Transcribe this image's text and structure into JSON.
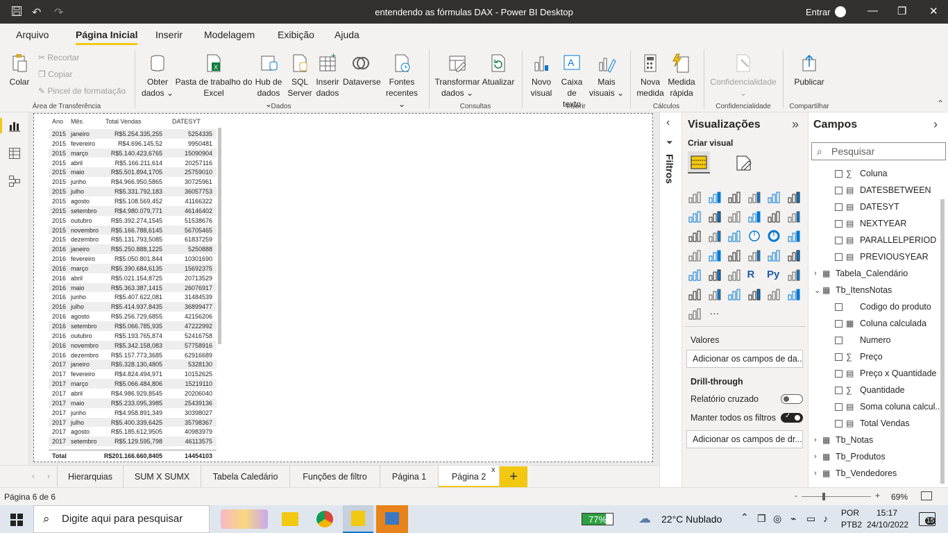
{
  "window": {
    "title": "entendendo as fórmulas DAX - Power BI Desktop",
    "signin": "Entrar"
  },
  "menu": {
    "tabs": [
      "Arquivo",
      "Página Inicial",
      "Inserir",
      "Modelagem",
      "Exibição",
      "Ajuda"
    ],
    "active": "Página Inicial"
  },
  "ribbon": {
    "colar": "Colar",
    "recortar": "Recortar",
    "copiar": "Copiar",
    "pincel": "Pincel de formatação",
    "group_transfer": "Área de Transferência",
    "obter_1": "Obter",
    "obter_2": "dados",
    "excel_1": "Pasta de trabalho do",
    "excel_2": "Excel",
    "hub_1": "Hub de",
    "hub_2": "dados",
    "sql_1": "SQL",
    "sql_2": "Server",
    "inserir_1": "Inserir",
    "inserir_2": "dados",
    "dataverse": "Dataverse",
    "fontes_1": "Fontes",
    "fontes_2": "recentes",
    "group_dados": "Dados",
    "transformar_1": "Transformar",
    "transformar_2": "dados",
    "atualizar": "Atualizar",
    "group_consultas": "Consultas",
    "novo_1": "Novo",
    "novo_2": "visual",
    "caixa_1": "Caixa de",
    "caixa_2": "texto",
    "mais_1": "Mais",
    "mais_2": "visuais",
    "group_inserir": "Inserir",
    "nova_1": "Nova",
    "nova_2": "medida",
    "medida_1": "Medida",
    "medida_2": "rápida",
    "group_calculos": "Cálculos",
    "confid": "Confidencialidade",
    "group_confid": "Confidencialidade",
    "publicar": "Publicar",
    "group_compartilhar": "Compartilhar"
  },
  "table": {
    "headers": [
      "Ano",
      "Mês",
      "Total Vendas",
      "DATESYT"
    ],
    "rows": [
      [
        "2015",
        "janeiro",
        "R$5.254.335,255",
        "5254335"
      ],
      [
        "2015",
        "fevereiro",
        "R$4.696.145,52",
        "9950481"
      ],
      [
        "2015",
        "março",
        "R$5.140.423,6765",
        "15090904"
      ],
      [
        "2015",
        "abril",
        "R$5.166.211,614",
        "20257116"
      ],
      [
        "2015",
        "maio",
        "R$5.501.894,1705",
        "25759010"
      ],
      [
        "2015",
        "junho",
        "R$4.966.950,5865",
        "30725961"
      ],
      [
        "2015",
        "julho",
        "R$5.331.792,183",
        "36057753"
      ],
      [
        "2015",
        "agosto",
        "R$5.108.569,452",
        "41166322"
      ],
      [
        "2015",
        "setembro",
        "R$4.980.079,771",
        "46146402"
      ],
      [
        "2015",
        "outubro",
        "R$5.392.274,1545",
        "51538676"
      ],
      [
        "2015",
        "novembro",
        "R$5.166.788,6145",
        "56705465"
      ],
      [
        "2015",
        "dezembro",
        "R$5.131.793,5085",
        "61837259"
      ],
      [
        "2016",
        "janeiro",
        "R$5.250.888,1225",
        "5250888"
      ],
      [
        "2016",
        "fevereiro",
        "R$5.050.801,844",
        "10301690"
      ],
      [
        "2016",
        "março",
        "R$5.390.684,6135",
        "15692375"
      ],
      [
        "2016",
        "abril",
        "R$5.021.154,8725",
        "20713529"
      ],
      [
        "2016",
        "maio",
        "R$5.363.387,1415",
        "26076917"
      ],
      [
        "2016",
        "junho",
        "R$5.407.622,081",
        "31484539"
      ],
      [
        "2016",
        "julho",
        "R$5.414.937,8435",
        "36899477"
      ],
      [
        "2016",
        "agosto",
        "R$5.256.729,6855",
        "42156206"
      ],
      [
        "2016",
        "setembro",
        "R$5.066.785,935",
        "47222992"
      ],
      [
        "2016",
        "outubro",
        "R$5.193.765,874",
        "52416758"
      ],
      [
        "2016",
        "novembro",
        "R$5.342.158,083",
        "57758916"
      ],
      [
        "2016",
        "dezembro",
        "R$5.157.773,3685",
        "62916689"
      ],
      [
        "2017",
        "janeiro",
        "R$5.328.130,4805",
        "5328130"
      ],
      [
        "2017",
        "fevereiro",
        "R$4.824.494,971",
        "10152625"
      ],
      [
        "2017",
        "março",
        "R$5.066.484,806",
        "15219110"
      ],
      [
        "2017",
        "abril",
        "R$4.986.929,8545",
        "20206040"
      ],
      [
        "2017",
        "maio",
        "R$5.233.095,3985",
        "25439136"
      ],
      [
        "2017",
        "junho",
        "R$4.958.891,349",
        "30398027"
      ],
      [
        "2017",
        "julho",
        "R$5.400.339,6425",
        "35798367"
      ],
      [
        "2017",
        "agosto",
        "R$5.185.612,9505",
        "40983979"
      ],
      [
        "2017",
        "setembro",
        "R$5.129.595,798",
        "46113575"
      ]
    ],
    "total_label": "Total",
    "total_vendas": "R$201.166.660,8405",
    "total_dyt": "14454103"
  },
  "pagetabs": {
    "tabs": [
      "Hierarquias",
      "SUM X SUMX",
      "Tabela Caledário",
      "Funções de filtro",
      "Página 1",
      "Página 2"
    ],
    "active": "Página 2",
    "close": "x",
    "add": "+"
  },
  "status": {
    "page": "Página 6 de 6",
    "zoom": "69%",
    "minus": "-",
    "plus": "+"
  },
  "filtros": {
    "label": "Filtros"
  },
  "viz": {
    "title": "Visualizações",
    "criar": "Criar visual",
    "valores": "Valores",
    "valores_drop": "Adicionar os campos de da...",
    "drill": "Drill-through",
    "relatorio": "Relatório cruzado",
    "manter": "Manter todos os filtros",
    "drill_drop": "Adicionar os campos de dr...",
    "more": "···"
  },
  "campos": {
    "title": "Campos",
    "search_placeholder": "Pesquisar",
    "items": [
      {
        "label": "Coluna",
        "type": "sigma-col"
      },
      {
        "label": "DATESBETWEEN",
        "type": "calc"
      },
      {
        "label": "DATESYT",
        "type": "calc"
      },
      {
        "label": "NEXTYEAR",
        "type": "calc"
      },
      {
        "label": "PARALLELPERIOD",
        "type": "calc"
      },
      {
        "label": "PREVIOUSYEAR",
        "type": "calc"
      }
    ],
    "tables": [
      "Tabela_Calendário",
      "Tb_ItensNotas",
      "Tb_Notas",
      "Tb_Produtos",
      "Tb_Vendedores"
    ],
    "itens_fields": [
      "Codigo do produto",
      "Coluna calculada",
      "Numero",
      "Preço",
      "Preço x Quantidade",
      "Quantidade",
      "Soma coluna calcul...",
      "Total Vendas"
    ]
  },
  "taskbar": {
    "search": "Digite aqui para pesquisar",
    "battery": "77%",
    "weather": "22°C  Nublado",
    "lang1": "POR",
    "lang2": "PTB2",
    "time": "15:17",
    "date": "24/10/2022",
    "notif": "15"
  },
  "colors": {
    "accent": "#f2c811",
    "titlebar": "#323130",
    "ribbon": "#f3f2f1"
  }
}
